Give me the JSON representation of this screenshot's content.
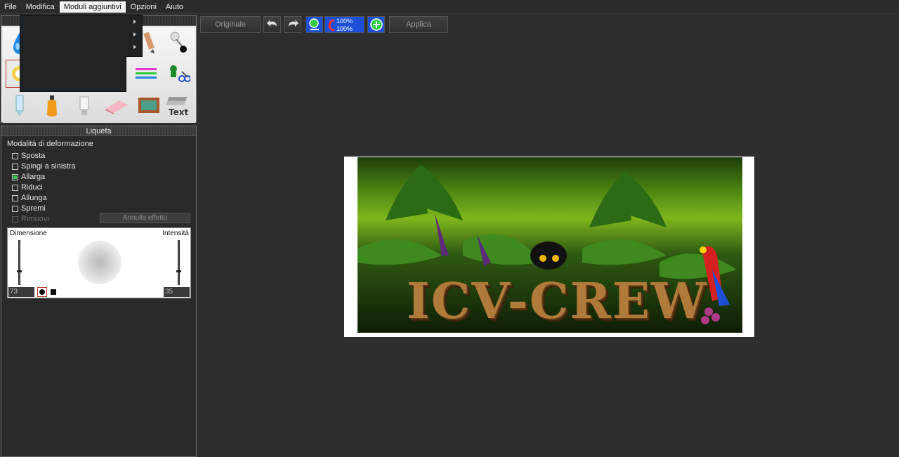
{
  "menu": {
    "items": [
      {
        "label": "File"
      },
      {
        "label": "Modifica"
      },
      {
        "label": "Moduli aggiuntivi"
      },
      {
        "label": "Opzioni"
      },
      {
        "label": "Aiuto"
      }
    ]
  },
  "toolbar": {
    "originale_label": "Originale",
    "applica_label": "Applica",
    "zoom_top": "100%",
    "zoom_bottom": "100%"
  },
  "liquefa": {
    "title": "Liquefa",
    "group_title": "Modalità di deformazione",
    "options": [
      {
        "label": "Sposta",
        "checked": false,
        "enabled": true
      },
      {
        "label": "Spingi a sinistra",
        "checked": false,
        "enabled": true
      },
      {
        "label": "Allarga",
        "checked": true,
        "enabled": true
      },
      {
        "label": "Riduci",
        "checked": false,
        "enabled": true
      },
      {
        "label": "Allunga",
        "checked": false,
        "enabled": true
      },
      {
        "label": "Spremi",
        "checked": false,
        "enabled": true
      },
      {
        "label": "Rimuovi",
        "checked": false,
        "enabled": false
      }
    ],
    "annulla_label": "Annulla effetto",
    "dimension_label": "Dimensione",
    "intensity_label": "Intensità",
    "dimension_value": "73",
    "intensity_value": "35"
  },
  "canvas_image": {
    "title_text": "ICV-CREW"
  },
  "colors": {
    "background": "#2e2e2e",
    "active_check": "#2ecc40",
    "selection_border": "#c0392b",
    "zoom_blue": "#1c4fd6"
  }
}
